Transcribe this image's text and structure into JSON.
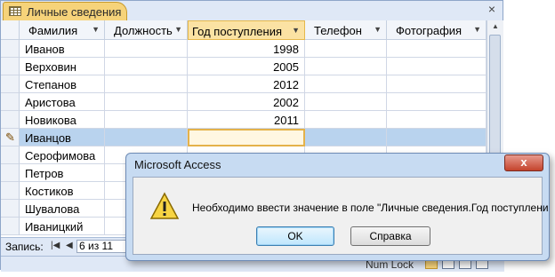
{
  "tab": {
    "title": "Личные сведения",
    "close_glyph": "×"
  },
  "columns": [
    {
      "label": "Фамилия"
    },
    {
      "label": "Должность"
    },
    {
      "label": "Год поступления"
    },
    {
      "label": "Телефон"
    },
    {
      "label": "Фотография"
    }
  ],
  "rows": [
    {
      "surname": "Иванов",
      "position": "",
      "year": "1998",
      "phone": "",
      "photo": ""
    },
    {
      "surname": "Верховин",
      "position": "",
      "year": "2005",
      "phone": "",
      "photo": ""
    },
    {
      "surname": "Степанов",
      "position": "",
      "year": "2012",
      "phone": "",
      "photo": ""
    },
    {
      "surname": "Аристова",
      "position": "",
      "year": "2002",
      "phone": "",
      "photo": ""
    },
    {
      "surname": "Новикова",
      "position": "",
      "year": "2011",
      "phone": "",
      "photo": ""
    },
    {
      "surname": "Иванцов",
      "position": "",
      "year": "",
      "phone": "",
      "photo": ""
    },
    {
      "surname": "Серофимова",
      "position": "",
      "year": "",
      "phone": "",
      "photo": ""
    },
    {
      "surname": "Петров",
      "position": "",
      "year": "",
      "phone": "",
      "photo": ""
    },
    {
      "surname": "Костиков",
      "position": "",
      "year": "",
      "phone": "",
      "photo": ""
    },
    {
      "surname": "Шувалова",
      "position": "",
      "year": "",
      "phone": "",
      "photo": ""
    },
    {
      "surname": "Иваницкий",
      "position": "",
      "year": "",
      "phone": "",
      "photo": ""
    }
  ],
  "active_row_index": 5,
  "navigation": {
    "record_label": "Запись:",
    "record_value": "6 из 11"
  },
  "status": {
    "numlock": "Num Lock"
  },
  "dialog": {
    "title": "Microsoft Access",
    "message": "Необходимо ввести значение в поле \"Личные сведения.Год поступления\".",
    "ok_label": "OK",
    "help_label": "Справка",
    "close_glyph": "x"
  },
  "colors": {
    "tab_accent": "#f6d37a",
    "selected_row": "#b9d3ee",
    "dialog_frame": "#c7dbf2"
  }
}
